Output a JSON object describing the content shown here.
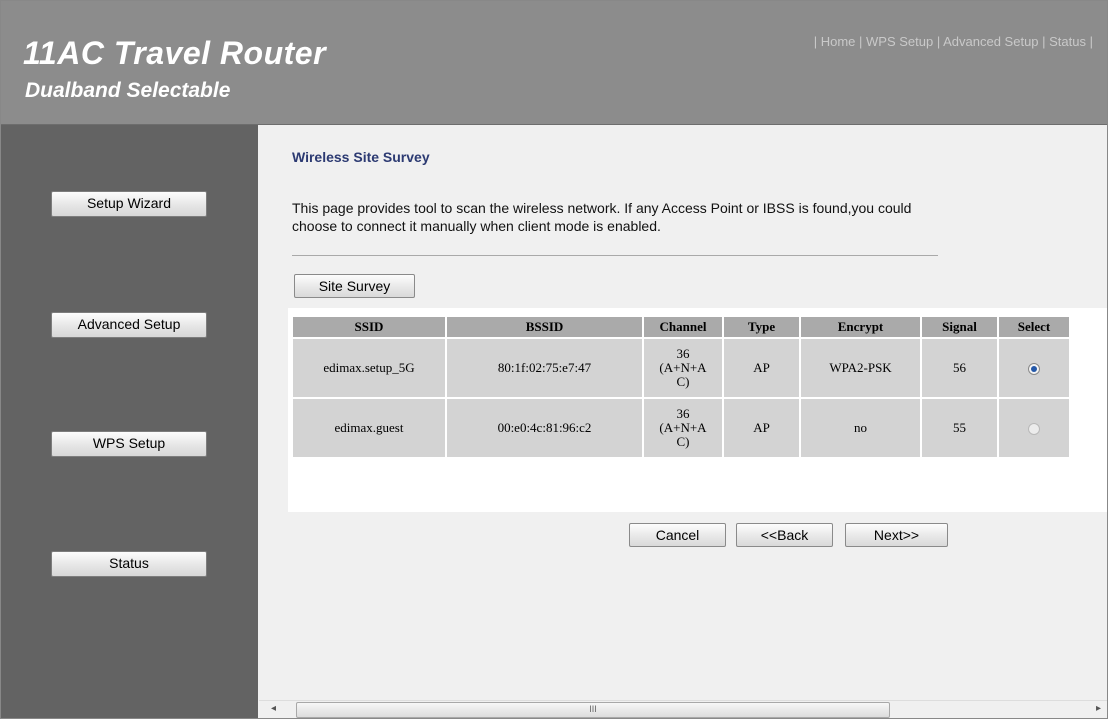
{
  "header": {
    "title": "11AC Travel Router",
    "subtitle": "Dualband Selectable",
    "nav": [
      "Home",
      "WPS Setup",
      "Advanced Setup",
      "Status"
    ]
  },
  "sidebar": {
    "buttons": [
      "Setup Wizard",
      "Advanced Setup",
      "WPS Setup",
      "Status"
    ]
  },
  "main": {
    "page_title": "Wireless Site Survey",
    "description": "This page provides tool to scan the wireless network. If any Access Point or IBSS is found,you could choose to connect it manually when client mode is enabled.",
    "site_survey_label": "Site Survey",
    "table": {
      "headers": [
        "SSID",
        "BSSID",
        "Channel",
        "Type",
        "Encrypt",
        "Signal",
        "Select"
      ],
      "rows": [
        {
          "ssid": "edimax.setup_5G",
          "bssid": "80:1f:02:75:e7:47",
          "channel_num": "36",
          "channel_mode_a": "(A+N+A",
          "channel_mode_b": "C)",
          "type": "AP",
          "encrypt": "WPA2-PSK",
          "signal": "56",
          "selected": true
        },
        {
          "ssid": "edimax.guest",
          "bssid": "00:e0:4c:81:96:c2",
          "channel_num": "36",
          "channel_mode_a": "(A+N+A",
          "channel_mode_b": "C)",
          "type": "AP",
          "encrypt": "no",
          "signal": "55",
          "selected": false
        }
      ]
    },
    "buttons": {
      "cancel": "Cancel",
      "back": "<<Back",
      "next": "Next>>"
    }
  },
  "scrollbar": {
    "grip": "III"
  },
  "colors": {
    "header_bg": "#8c8c8c",
    "sidebar_bg": "#636363",
    "title_blue": "#2c3a72"
  }
}
